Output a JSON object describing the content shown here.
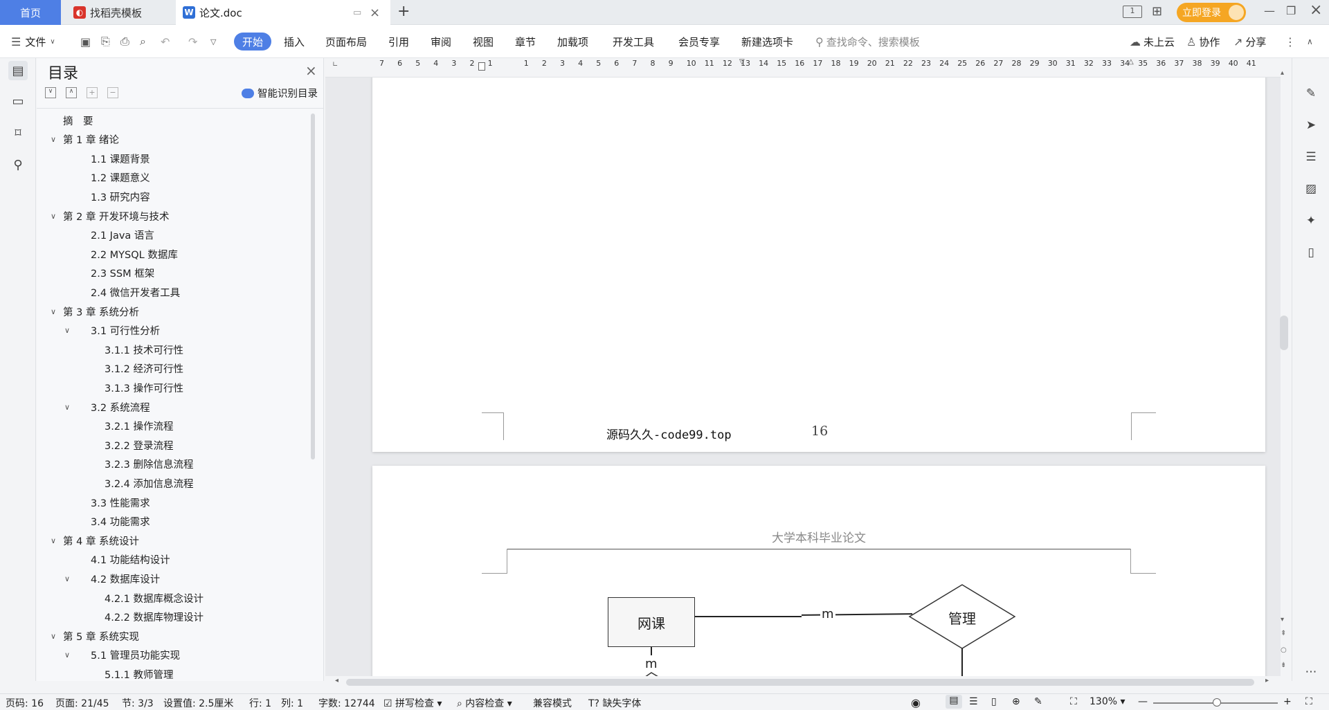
{
  "tabs": {
    "home": "首页",
    "template": "找稻壳模板",
    "doc": "论文.doc",
    "login_button": "立即登录"
  },
  "toolbar": {
    "file": "文件",
    "start": "开始",
    "insert": "插入",
    "layout": "页面布局",
    "reference": "引用",
    "review": "审阅",
    "view": "视图",
    "section": "章节",
    "addons": "加载项",
    "devtools": "开发工具",
    "member": "会员专享",
    "newtab": "新建选项卡",
    "search_placeholder": "查找命令、搜索模板",
    "cloud": "未上云",
    "collab": "协作",
    "share": "分享"
  },
  "toc": {
    "title": "目录",
    "smart": "智能识别目录",
    "items": [
      "摘　要",
      "第 1 章  绪论",
      "1.1  课题背景",
      "1.2  课题意义",
      "1.3  研究内容",
      "第 2 章  开发环境与技术",
      "2.1 Java 语言",
      "2.2 MYSQL 数据库",
      "2.3 SSM 框架",
      "2.4 微信开发者工具",
      "第 3 章  系统分析",
      "3.1  可行性分析",
      "3.1.1  技术可行性",
      "3.1.2  经济可行性",
      "3.1.3  操作可行性",
      "3.2  系统流程",
      "3.2.1  操作流程",
      "3.2.2  登录流程",
      "3.2.3  删除信息流程",
      "3.2.4  添加信息流程",
      "3.3  性能需求",
      "3.4  功能需求",
      "第 4 章  系统设计",
      "4.1  功能结构设计",
      "4.2  数据库设计",
      "4.2.1  数据库概念设计",
      "4.2.2  数据库物理设计",
      "第 5 章  系统实现",
      "5.1  管理员功能实现",
      "5.1.1  教师管理"
    ]
  },
  "ruler": {
    "numbers": [
      "7",
      "6",
      "5",
      "4",
      "3",
      "2",
      "1",
      "",
      "1",
      "2",
      "3",
      "4",
      "5",
      "6",
      "7",
      "8",
      "9",
      "10",
      "11",
      "12",
      "13",
      "14",
      "15",
      "16",
      "17",
      "18",
      "19",
      "20",
      "21",
      "22",
      "23",
      "24",
      "25",
      "26",
      "27",
      "28",
      "29",
      "30",
      "31",
      "32",
      "33",
      "34",
      "35",
      "36",
      "37",
      "38",
      "39",
      "40",
      "41"
    ]
  },
  "document": {
    "footer_text": "源码久久-code99.top",
    "page_number": "16",
    "header_text": "大学本科毕业论文",
    "er": {
      "entity": "网课",
      "relation": "管理",
      "card1": "m",
      "card2": "m"
    }
  },
  "status": {
    "page_code": "页码: 16",
    "page": "页面: 21/45",
    "section": "节: 3/3",
    "setting": "设置值: 2.5厘米",
    "row": "行: 1",
    "col": "列: 1",
    "words": "字数: 12744",
    "spell": "拼写检查",
    "content": "内容检查",
    "compat": "兼容模式",
    "missing_font": "缺失字体",
    "zoom": "130%"
  },
  "colors": {
    "accent": "#4e7fe5",
    "login": "#f5a623"
  }
}
